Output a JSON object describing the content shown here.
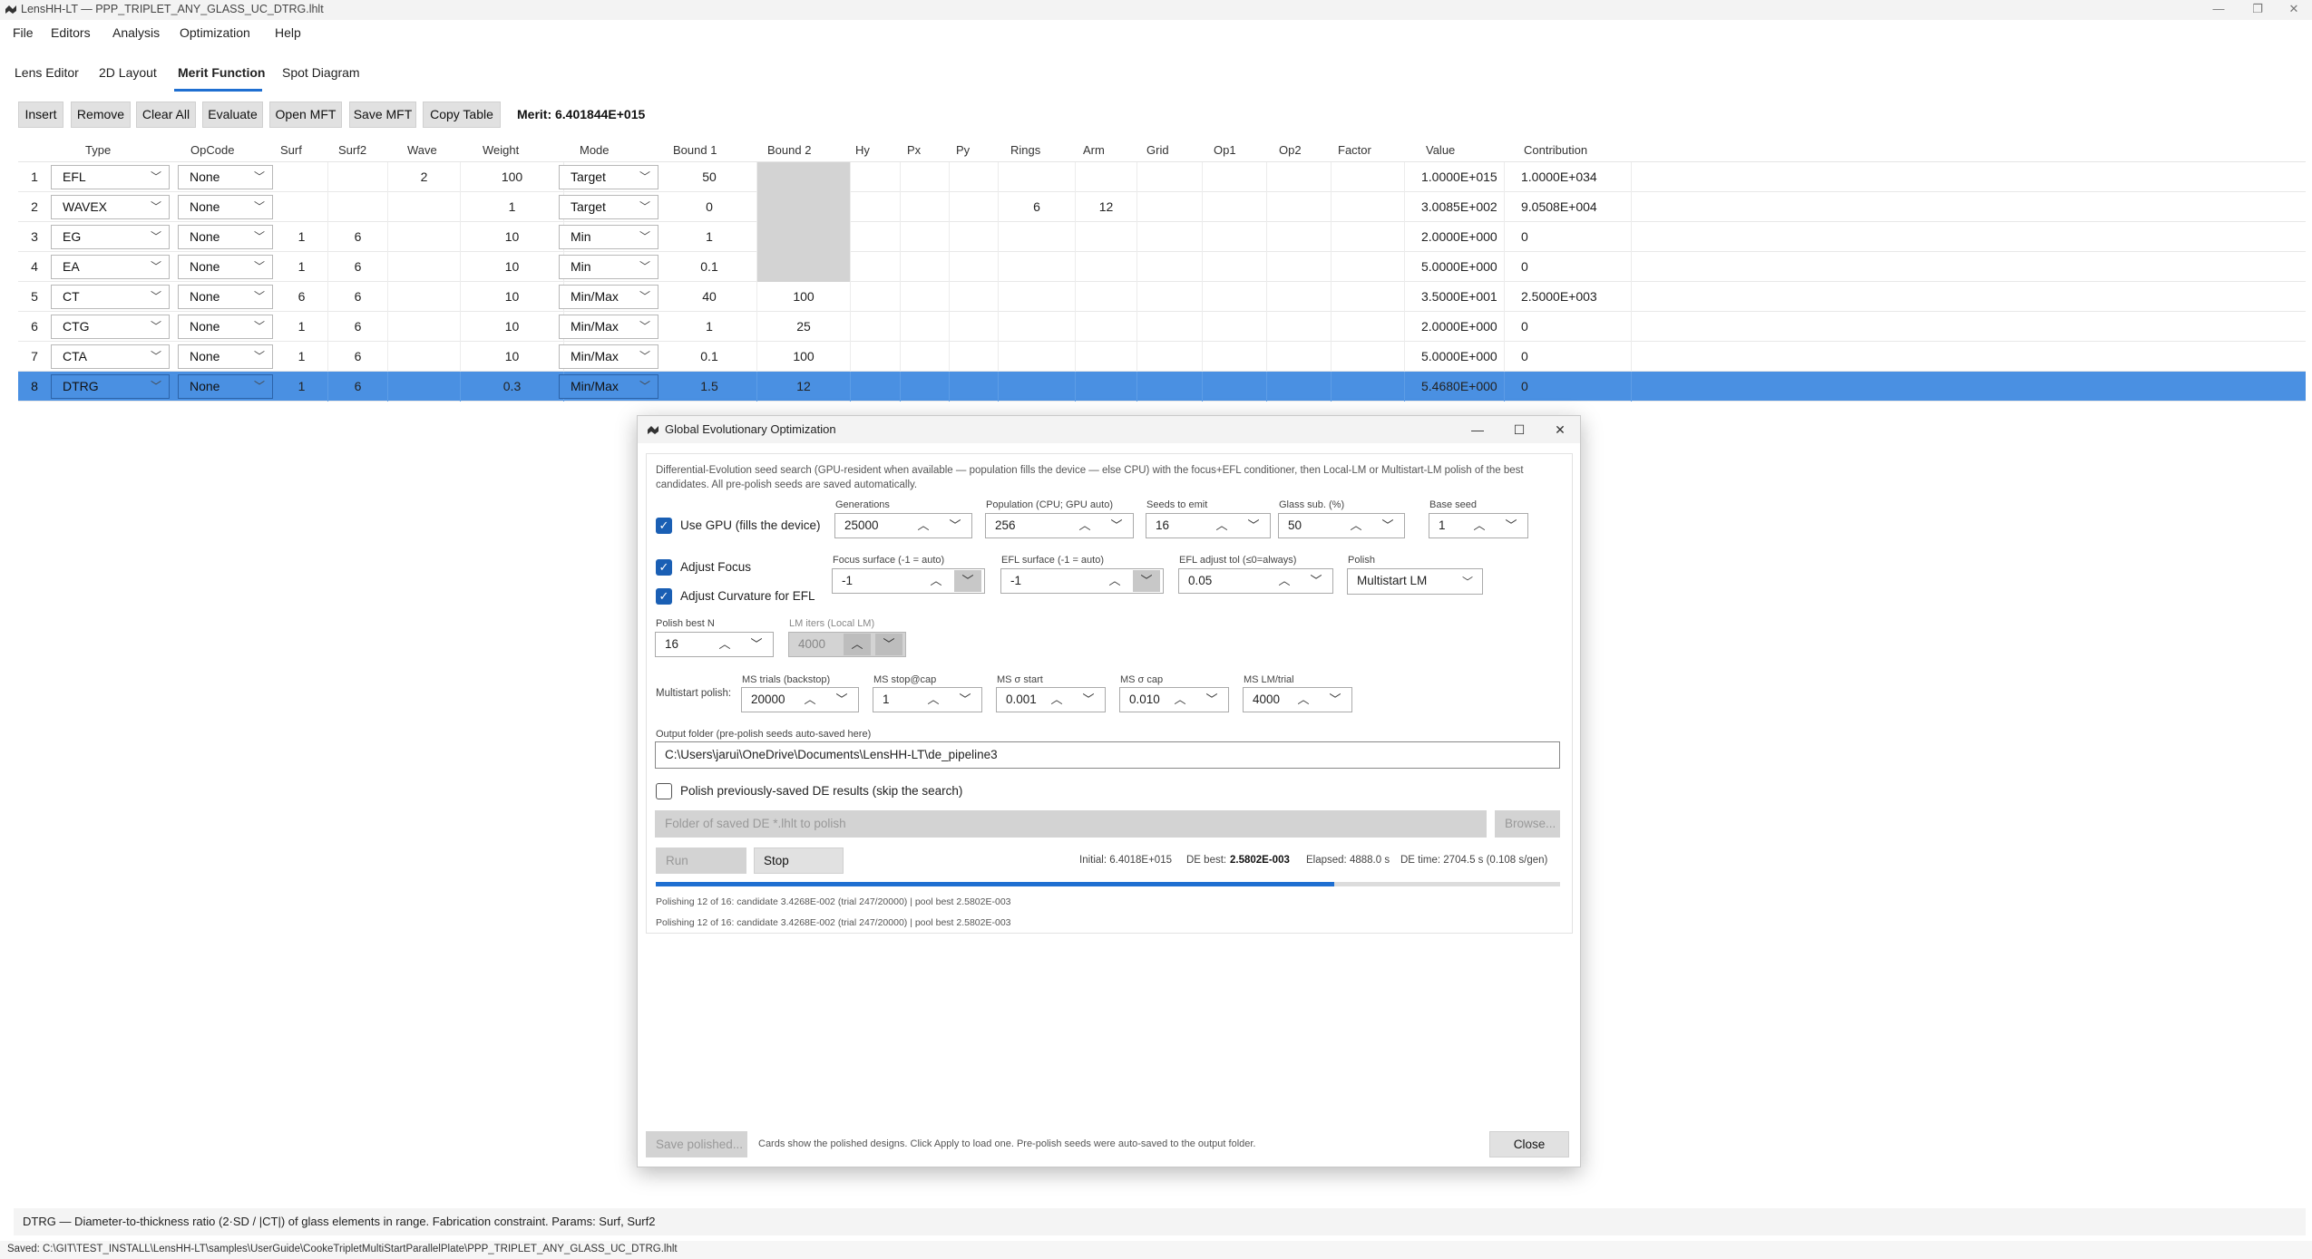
{
  "window": {
    "title": "LensHH-LT — PPP_TRIPLET_ANY_GLASS_UC_DTRG.lhlt"
  },
  "menu": [
    "File",
    "Editors",
    "Analysis",
    "Optimization",
    "Help"
  ],
  "tabs": [
    "Lens Editor",
    "2D Layout",
    "Merit Function",
    "Spot Diagram"
  ],
  "toolbar": {
    "buttons": [
      "Insert",
      "Remove",
      "Clear All",
      "Evaluate",
      "Open MFT",
      "Save MFT",
      "Copy Table"
    ],
    "merit": "Merit: 6.401844E+015"
  },
  "table": {
    "headers": [
      "Type",
      "OpCode",
      "Surf",
      "Surf2",
      "Wave",
      "Weight",
      "Mode",
      "Bound 1",
      "Bound 2",
      "Hy",
      "Px",
      "Py",
      "Rings",
      "Arm",
      "Grid",
      "Op1",
      "Op2",
      "Factor",
      "Value",
      "Contribution"
    ],
    "rows": [
      {
        "n": "1",
        "type": "EFL",
        "opcode": "None",
        "surf": "",
        "surf2": "",
        "wave": "2",
        "weight": "100",
        "mode": "Target",
        "b1": "50",
        "b2": "",
        "rings": "",
        "arm": "",
        "value": "1.0000E+015",
        "contrib": "1.0000E+034"
      },
      {
        "n": "2",
        "type": "WAVEX",
        "opcode": "None",
        "surf": "",
        "surf2": "",
        "wave": "",
        "weight": "1",
        "mode": "Target",
        "b1": "0",
        "b2": "",
        "rings": "6",
        "arm": "12",
        "value": "3.0085E+002",
        "contrib": "9.0508E+004"
      },
      {
        "n": "3",
        "type": "EG",
        "opcode": "None",
        "surf": "1",
        "surf2": "6",
        "wave": "",
        "weight": "10",
        "mode": "Min",
        "b1": "1",
        "b2": "",
        "rings": "",
        "arm": "",
        "value": "2.0000E+000",
        "contrib": "0"
      },
      {
        "n": "4",
        "type": "EA",
        "opcode": "None",
        "surf": "1",
        "surf2": "6",
        "wave": "",
        "weight": "10",
        "mode": "Min",
        "b1": "0.1",
        "b2": "",
        "rings": "",
        "arm": "",
        "value": "5.0000E+000",
        "contrib": "0"
      },
      {
        "n": "5",
        "type": "CT",
        "opcode": "None",
        "surf": "6",
        "surf2": "6",
        "wave": "",
        "weight": "10",
        "mode": "Min/Max",
        "b1": "40",
        "b2": "100",
        "rings": "",
        "arm": "",
        "value": "3.5000E+001",
        "contrib": "2.5000E+003"
      },
      {
        "n": "6",
        "type": "CTG",
        "opcode": "None",
        "surf": "1",
        "surf2": "6",
        "wave": "",
        "weight": "10",
        "mode": "Min/Max",
        "b1": "1",
        "b2": "25",
        "rings": "",
        "arm": "",
        "value": "2.0000E+000",
        "contrib": "0"
      },
      {
        "n": "7",
        "type": "CTA",
        "opcode": "None",
        "surf": "1",
        "surf2": "6",
        "wave": "",
        "weight": "10",
        "mode": "Min/Max",
        "b1": "0.1",
        "b2": "100",
        "rings": "",
        "arm": "",
        "value": "5.0000E+000",
        "contrib": "0"
      },
      {
        "n": "8",
        "type": "DTRG",
        "opcode": "None",
        "surf": "1",
        "surf2": "6",
        "wave": "",
        "weight": "0.3",
        "mode": "Min/Max",
        "b1": "1.5",
        "b2": "12",
        "rings": "",
        "arm": "",
        "value": "5.4680E+000",
        "contrib": "0"
      }
    ]
  },
  "dialog": {
    "title": "Global Evolutionary Optimization",
    "description": "Differential-Evolution seed search (GPU-resident when available — population fills the device — else CPU) with the focus+EFL conditioner, then Local-LM or Multistart-LM polish of the best candidates. All pre-polish seeds are saved automatically.",
    "use_gpu": "Use GPU (fills the device)",
    "adjust_focus": "Adjust Focus",
    "adjust_curv": "Adjust Curvature for EFL",
    "generations": {
      "label": "Generations",
      "value": "25000"
    },
    "population": {
      "label": "Population (CPU; GPU auto)",
      "value": "256"
    },
    "seeds": {
      "label": "Seeds to emit",
      "value": "16"
    },
    "glass_sub": {
      "label": "Glass sub. (%)",
      "value": "50"
    },
    "base_seed": {
      "label": "Base seed",
      "value": "1"
    },
    "focus_surface": {
      "label": "Focus surface (-1 = auto)",
      "value": "-1"
    },
    "efl_surface": {
      "label": "EFL surface (-1 = auto)",
      "value": "-1"
    },
    "efl_tol": {
      "label": "EFL adjust tol (≤0=always)",
      "value": "0.05"
    },
    "polish": {
      "label": "Polish",
      "value": "Multistart LM"
    },
    "polish_best": {
      "label": "Polish best N",
      "value": "16"
    },
    "lm_iters": {
      "label": "LM iters (Local LM)",
      "value": "4000"
    },
    "multistart_label": "Multistart polish:",
    "ms_trials": {
      "label": "MS trials (backstop)",
      "value": "20000"
    },
    "ms_stop": {
      "label": "MS stop@cap",
      "value": "1"
    },
    "ms_sigma_start": {
      "label": "MS σ start",
      "value": "0.001"
    },
    "ms_sigma_cap": {
      "label": "MS σ cap",
      "value": "0.010"
    },
    "ms_lm_trial": {
      "label": "MS LM/trial",
      "value": "4000"
    },
    "output_folder": {
      "label": "Output folder (pre-polish seeds auto-saved here)",
      "value": "C:\\Users\\jarui\\OneDrive\\Documents\\LensHH-LT\\de_pipeline3"
    },
    "polish_saved": "Polish previously-saved DE results (skip the search)",
    "saved_folder_placeholder": "Folder of saved DE *.lhlt to polish",
    "browse": "Browse...",
    "run": "Run",
    "stop": "Stop",
    "initial": "Initial: 6.4018E+015",
    "de_best_label": "DE best:",
    "de_best": "2.5802E-003",
    "elapsed": "Elapsed: 4888.0 s",
    "de_time": "DE time: 2704.5 s (0.108 s/gen)",
    "progress": 0.75,
    "log1": "Polishing 12 of 16: candidate 3.4268E-002 (trial 247/20000) | pool best 2.5802E-003",
    "log2": "Polishing 12 of 16: candidate 3.4268E-002 (trial 247/20000) | pool best 2.5802E-003",
    "save_polished": "Save polished...",
    "footer_note": "Cards show the polished designs. Click Apply to load one. Pre-polish seeds were auto-saved to the output folder.",
    "close": "Close"
  },
  "help_text": "DTRG — Diameter-to-thickness ratio (2·SD / |CT|) of glass elements in range. Fabrication constraint. Params: Surf, Surf2",
  "status": "Saved: C:\\GIT\\TEST_INSTALL\\LensHH-LT\\samples\\UserGuide\\CookeTripletMultiStartParallelPlate\\PPP_TRIPLET_ANY_GLASS_UC_DTRG.lhlt"
}
